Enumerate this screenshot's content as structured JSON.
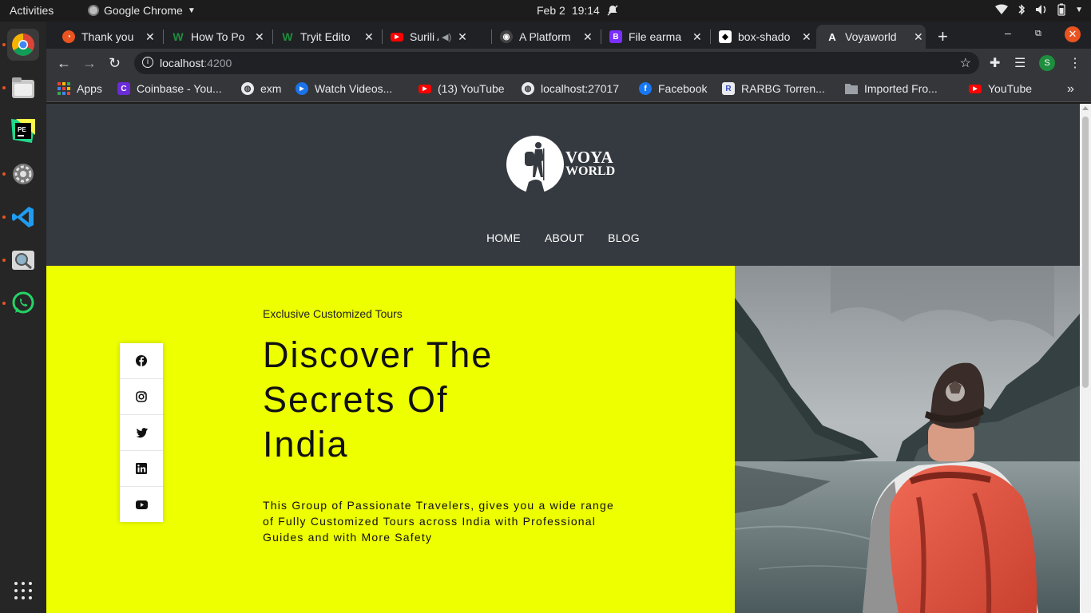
{
  "os": {
    "activities": "Activities",
    "app_name": "Google Chrome",
    "date": "Feb 2",
    "time": "19:14"
  },
  "browser": {
    "tabs": [
      {
        "title": "Thank you",
        "favicon_color": "#e95420"
      },
      {
        "title": "How To Po",
        "favicon_color": "#1e8e3e"
      },
      {
        "title": "Tryit Edito",
        "favicon_color": "#1e8e3e"
      },
      {
        "title": "Surili Al",
        "favicon_color": "#ff0000"
      },
      {
        "title": "A Platform",
        "favicon_color": "#444444"
      },
      {
        "title": "File earma",
        "favicon_color": "#7b2fff"
      },
      {
        "title": "box-shado",
        "favicon_color": "#ffffff"
      },
      {
        "title": "Voyaworld",
        "favicon_color": "#ffffff",
        "active": true
      }
    ],
    "url_host": "localhost",
    "url_port": ":4200",
    "profile_initial": "S",
    "bookmarks": [
      {
        "label": "Apps",
        "icon_color": "#4285f4"
      },
      {
        "label": "Coinbase - You...",
        "icon_color": "#6b2bd9"
      },
      {
        "label": "exm",
        "icon_color": "#e8eaed"
      },
      {
        "label": "Watch Videos...",
        "icon_color": "#1a73e8"
      },
      {
        "label": "(13) YouTube",
        "icon_color": "#ff0000"
      },
      {
        "label": "localhost:27017",
        "icon_color": "#e8eaed"
      },
      {
        "label": "Facebook",
        "icon_color": "#1877f2"
      },
      {
        "label": "RARBG Torren...",
        "icon_color": "#3b4cc0"
      },
      {
        "label": "Imported Fro...",
        "icon_color": "#9aa0a6"
      },
      {
        "label": "YouTube",
        "icon_color": "#ff0000"
      }
    ]
  },
  "site": {
    "logo_line1": "VOYA",
    "logo_line2": "WORLD",
    "nav": [
      "HOME",
      "ABOUT",
      "BLOG"
    ],
    "kicker": "Exclusive Customized Tours",
    "headline": "Discover The Secrets Of India",
    "copy": "This Group of Passionate Travelers, gives you a wide range of Fully Customized Tours across India with Professional Guides and with More Safety",
    "social": [
      "facebook",
      "instagram",
      "twitter",
      "linkedin",
      "youtube"
    ],
    "colors": {
      "header_bg": "#353a40",
      "hero_bg": "#eeff00",
      "backpack": "#e2533e"
    }
  }
}
